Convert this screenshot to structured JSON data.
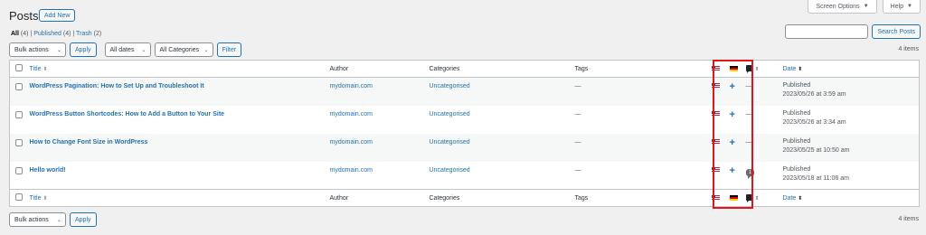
{
  "screen_options": {
    "screen_label": "Screen Options",
    "help_label": "Help"
  },
  "header": {
    "title": "Posts",
    "add_new": "Add New"
  },
  "views": {
    "all_label": "All",
    "all_count": "(4)",
    "published_label": "Published",
    "published_count": "(4)",
    "trash_label": "Trash",
    "trash_count": "(2)"
  },
  "search": {
    "button": "Search Posts",
    "value": ""
  },
  "filters": {
    "bulk_actions": "Bulk actions",
    "apply": "Apply",
    "dates": "All dates",
    "categories": "All Categories",
    "filter": "Filter"
  },
  "items_count": "4 items",
  "columns": {
    "title": "Title",
    "author": "Author",
    "categories": "Categories",
    "tags": "Tags",
    "date": "Date"
  },
  "rows": [
    {
      "title": "WordPress Pagination: How to Set Up and Troubleshoot It",
      "author": "mydomain.com",
      "category": "Uncategorised",
      "tags": "—",
      "comments": "—",
      "status": "Published",
      "date": "2023/05/26 at 3:59 am"
    },
    {
      "title": "WordPress Button Shortcodes: How to Add a Button to Your Site",
      "author": "mydomain.com",
      "category": "Uncategorised",
      "tags": "—",
      "comments": "—",
      "status": "Published",
      "date": "2023/05/26 at 3:34 am"
    },
    {
      "title": "How to Change Font Size in WordPress",
      "author": "mydomain.com",
      "category": "Uncategorised",
      "tags": "—",
      "comments": "—",
      "status": "Published",
      "date": "2023/05/25 at 10:50 am"
    },
    {
      "title": "Hello world!",
      "author": "mydomain.com",
      "category": "Uncategorised",
      "tags": "—",
      "comments": "1",
      "status": "Published",
      "date": "2023/05/18 at 11:08 am"
    }
  ],
  "colors": {
    "link": "#2271b1",
    "highlight": "#e0161d"
  },
  "icons": [
    "flag-us-icon",
    "flag-de-icon",
    "comment-icon",
    "plus-icon",
    "sort-icon",
    "chevron-down-icon"
  ]
}
